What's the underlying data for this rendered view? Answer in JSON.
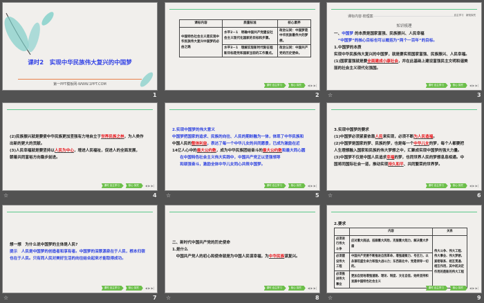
{
  "nav": {
    "btn1": "课时 自主学习",
    "btn2": "核心 探究",
    "arrows": "◀ ▶ ▶|"
  },
  "slides": [
    {
      "num": "1",
      "title": "课时2　实现中华民族伟大复兴的中国梦",
      "subtitle": "第一PPT模板网-WWW.1PPT.COM"
    },
    {
      "num": "2",
      "table": {
        "headers": [
          "课标内容",
          "质量标准",
          "核心素养"
        ],
        "left": "中国特色社会主义是实现中华民族伟大复兴中国梦的必由之路",
        "rows": [
          [
            "水平2－1　明确中国共产党建设社会主义现代化国家的目标和步骤。",
            "政治认同：中国梦是中华民族最伟大的梦想。"
          ],
          [
            "水平3－1　理解实现新时代新征程新目标是党和国家当前的工作重点。",
            "政治认同：中国共产党的历史使命。"
          ]
        ]
      }
    },
    {
      "num": "3",
      "header": "课标内容·梳理案",
      "header_right": "自主学习　新知探究",
      "section": "知识梳理",
      "lines": [
        [
          [
            "一、",
            ""
          ],
          [
            "中国梦",
            "blue"
          ],
          [
            " 的本质是国家富强、民族振兴、人民幸福",
            ""
          ]
        ],
        [
          [
            "　“中国梦”的核心目标也可以概括为“两个一百年”的目标。",
            "blue"
          ]
        ],
        [
          [
            "1.中国梦的本质",
            ""
          ]
        ],
        [
          [
            "实现中华民族伟大复兴的中国梦，就是要实现国家富强、民族振兴、人民幸福。",
            ""
          ]
        ],
        [
          [
            "(1)国家富强就是要",
            ""
          ],
          [
            "全面建成小康社会",
            "red"
          ],
          [
            "，并在此基础上建设富强民主文明和谐美",
            ""
          ]
        ],
        [
          [
            "丽的社会主义现代化强国。",
            ""
          ]
        ]
      ]
    },
    {
      "num": "4",
      "lines": [
        [
          [
            "(2)民族振兴就是要使中华民族更加坚强有力地自立于",
            ""
          ],
          [
            "世界民族之林",
            "red"
          ],
          [
            "，为人类作",
            ""
          ]
        ],
        [
          [
            "出新的更大的贡献。",
            ""
          ]
        ],
        [
          [
            "(3)人民幸福就是要坚持以",
            ""
          ],
          [
            "人民为中心",
            "red"
          ],
          [
            "，增进人民福祉，促进人的全面发展，",
            ""
          ]
        ],
        [
          [
            "朝着共同富裕方向稳步前进。",
            ""
          ]
        ]
      ]
    },
    {
      "num": "5",
      "lines": [
        [
          [
            "2.实现中国梦的伟大意义",
            "blue"
          ]
        ],
        [
          [
            "中国梦把国家的追求、民族的向往、人民的期盼融为一体，体现了中华民族和",
            "blue"
          ]
        ],
        [
          [
            "中国人民的",
            ""
          ],
          [
            "整体利益",
            "red"
          ],
          [
            "，表达了每一个中华儿女的共同愿景，已成为激励在近",
            "blue"
          ]
        ],
        [
          [
            "14亿人心中的",
            ""
          ],
          [
            "最大公约数",
            "red"
          ],
          [
            "，成为中华民族团结奋斗的",
            ""
          ],
          [
            "最大公约数",
            "red"
          ],
          [
            "和最大同心圆",
            "blue"
          ]
        ],
        [
          [
            "　　在中国特色社会主义伟大实践中，中国共产党正以坚强领导",
            "blue"
          ]
        ],
        [
          [
            "　　和顽强奋斗，激励全体中华儿女同心共筑中国梦。",
            "blue"
          ]
        ]
      ]
    },
    {
      "num": "6",
      "lines": [
        [
          [
            "3.实现中国梦的要求",
            ""
          ]
        ],
        [
          [
            "(1)中国梦必须紧紧依靠",
            ""
          ],
          [
            "人民",
            "red"
          ],
          [
            "来实现，必须不断",
            ""
          ],
          [
            "为人民造福",
            "red"
          ],
          [
            "。",
            ""
          ]
        ],
        [
          [
            "(2)中国梦是国家的梦、民族的梦，也是每一个",
            ""
          ],
          [
            "中华儿女",
            "red"
          ],
          [
            "的梦，每个人都要把",
            ""
          ]
        ],
        [
          [
            "人生理想融入国家和民族的伟大梦想之中，汇聚成实现中国梦的强大力量。",
            ""
          ]
        ],
        [
          [
            "(3)中国梦不仅是中国人民追求",
            ""
          ],
          [
            "幸福",
            "red"
          ],
          [
            "的梦，也同世界人民的梦想息息相通。中",
            ""
          ]
        ],
        [
          [
            "国将同国际社会一道，推动实现",
            ""
          ],
          [
            "持久和平",
            "red"
          ],
          [
            "、共同繁荣的世界梦。",
            ""
          ]
        ]
      ]
    },
    {
      "num": "7",
      "lines": [
        [
          [
            "想一想　为什么说中国梦的主体是人民?",
            ""
          ]
        ],
        [
          [
            "提示　人民是中国梦的创造者和享有者。中国梦的深厚源泉在于人民，根本归宿",
            "blue"
          ]
        ],
        [
          [
            "也在于人民。只有同人民对美好生活的向往结合起来才能取得成功。",
            "blue"
          ]
        ]
      ]
    },
    {
      "num": "8",
      "lines": [
        [
          [
            "二、新时代中国共产党的历史使命",
            ""
          ]
        ],
        [
          [
            "1.是什么",
            ""
          ]
        ],
        [
          [
            "　中国共产党人的初心和使命就是为中国人民谋幸福，为",
            ""
          ],
          [
            "中华民族",
            "red"
          ],
          [
            "谋复兴。",
            ""
          ]
        ]
      ]
    },
    {
      "num": "9",
      "heading": "2.要求",
      "table": {
        "headers": [
          "",
          "内容",
          "关系"
        ],
        "rows": [
          [
            "必须进行伟大斗争",
            "应对重大挑战，抵御重大风险，克服重大阻力，解决重大矛盾"
          ],
          [
            "必须建设伟大工程",
            "中国共产党要不断推进自我革命，增强凝聚力、号召力，以永葆旺盛生命力和强大战斗力；东西南北中，党是领导一切的。"
          ],
          [
            "必须推进伟大事业",
            "更加自觉地增强道路、理论、制度、文化自信，始终坚持和发展中国特色社会主义"
          ]
        ],
        "relation": "伟大斗争、伟大工程、伟大事业、伟大梦想，紧密联系、相互贯通、相互作用，其中起决定作用的是新的伟大工程"
      }
    }
  ],
  "colors": {
    "accent": "#5cc98a",
    "blue": "#2a3fe0",
    "red": "#e8141a"
  }
}
